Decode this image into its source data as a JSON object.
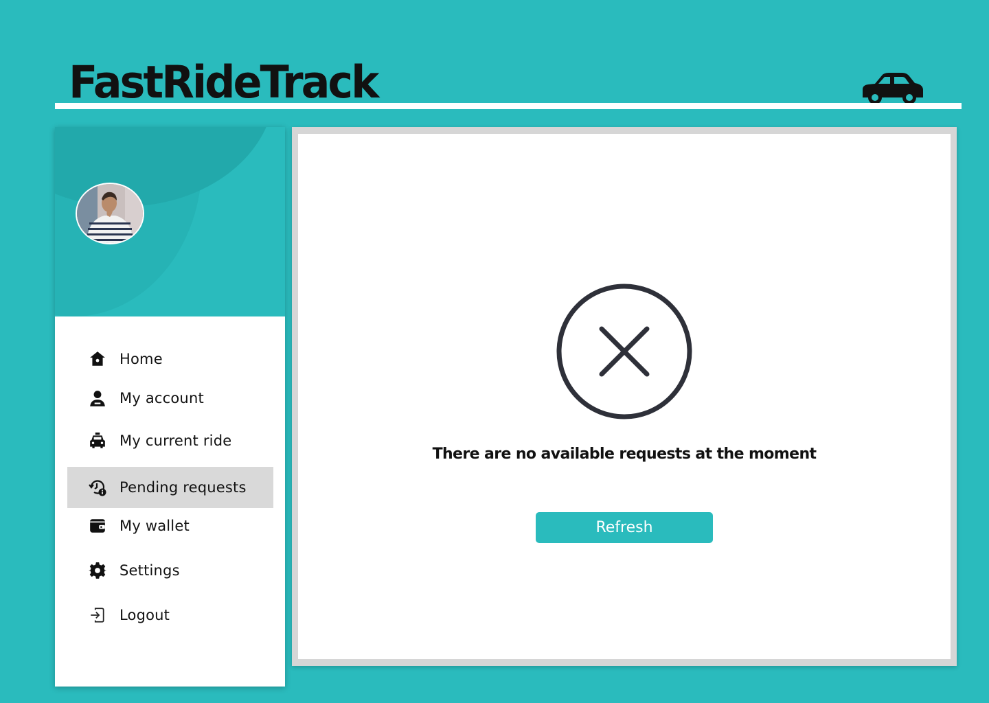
{
  "app": {
    "title": "FastRideTrack",
    "logo_icon": "car-icon",
    "accent_color": "#2abbbd"
  },
  "sidebar": {
    "avatar": "user-avatar-photo",
    "items": [
      {
        "label": "Home",
        "icon": "home-icon",
        "active": false
      },
      {
        "label": "My account",
        "icon": "user-icon",
        "active": false
      },
      {
        "label": "My current ride",
        "icon": "taxi-icon",
        "active": false
      },
      {
        "label": "Pending requests",
        "icon": "history-info-icon",
        "active": true
      },
      {
        "label": "My wallet",
        "icon": "wallet-icon",
        "active": false
      },
      {
        "label": "Settings",
        "icon": "gear-icon",
        "active": false
      },
      {
        "label": "Logout",
        "icon": "logout-icon",
        "active": false
      }
    ]
  },
  "main": {
    "empty_state": {
      "icon": "close-circle-icon",
      "message": "There are no available requests at the moment",
      "button_label": "Refresh"
    }
  }
}
